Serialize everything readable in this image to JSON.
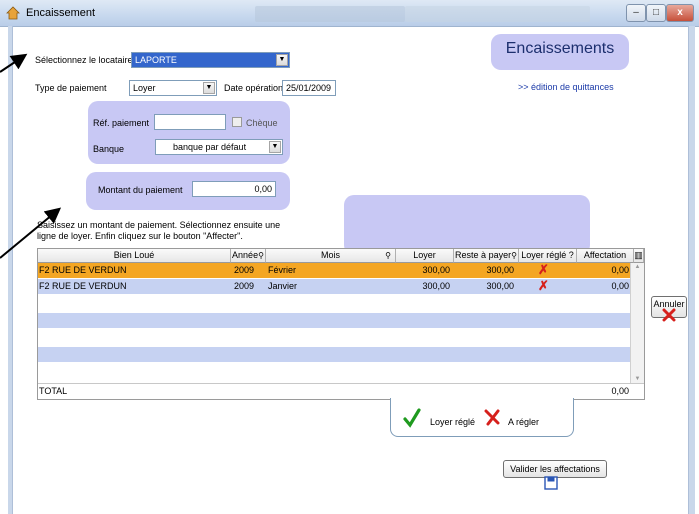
{
  "window": {
    "title": "Encaissement",
    "min": "–",
    "max": "□",
    "close": "x"
  },
  "header": {
    "title": "Encaissements",
    "link": ">> édition de quittances"
  },
  "form": {
    "locataire_label": "Sélectionnez le locataire",
    "locataire_value": "LAPORTE",
    "type_label": "Type de paiement",
    "type_value": "Loyer",
    "date_label": "Date opération",
    "date_value": "25/01/2009",
    "ref_label": "Réf. paiement",
    "ref_value": "",
    "cheque_label": "Chèque",
    "banque_label": "Banque",
    "banque_value": "banque par défaut",
    "montant_label": "Montant du paiement",
    "montant_value": "0,00"
  },
  "instructions": "Saisissez un montant de paiement. Sélectionnez ensuite une ligne de loyer. Enfin cliquez sur le bouton \"Affecter\".",
  "table": {
    "headers": [
      "Bien Loué",
      "Année",
      "Mois",
      "Loyer",
      "Reste à payer",
      "Loyer réglé ?",
      "Affectation"
    ],
    "rows": [
      {
        "bien": "F2 RUE DE VERDUN",
        "annee": "2009",
        "mois": "Février",
        "loyer": "300,00",
        "reste": "300,00",
        "regle": "✗",
        "affectation": "0,00"
      },
      {
        "bien": "F2 RUE DE VERDUN",
        "annee": "2009",
        "mois": "Janvier",
        "loyer": "300,00",
        "reste": "300,00",
        "regle": "✗",
        "affectation": "0,00"
      }
    ],
    "total_label": "TOTAL",
    "total_value": "0,00"
  },
  "legend": {
    "regle_label": "Loyer réglé",
    "aregler_label": "A régler"
  },
  "buttons": {
    "annuler": "Annuler",
    "valider": "Valider les affectations"
  },
  "colors": {
    "panel": "#c8c8f4",
    "selected_row": "#f4a623",
    "band_row": "#c6d2f2",
    "accent": "#3366cc"
  }
}
